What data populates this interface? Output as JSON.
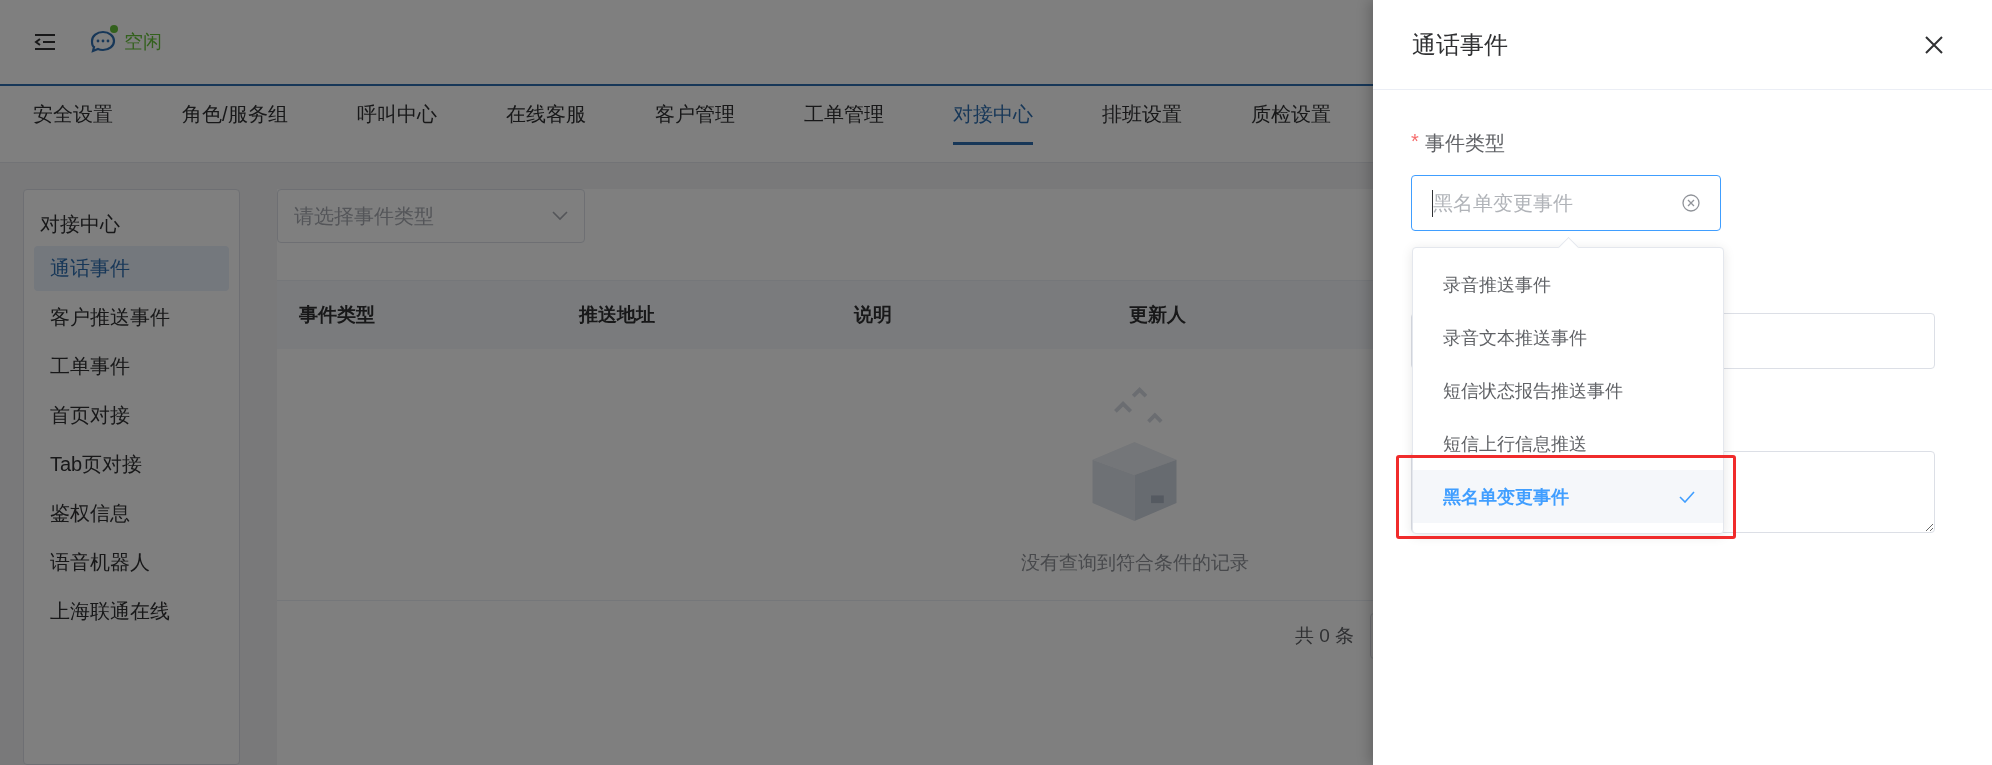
{
  "header": {
    "status": "空闲"
  },
  "nav_tabs": [
    {
      "label": "安全设置",
      "selected": false
    },
    {
      "label": "角色/服务组",
      "selected": false
    },
    {
      "label": "呼叫中心",
      "selected": false
    },
    {
      "label": "在线客服",
      "selected": false
    },
    {
      "label": "客户管理",
      "selected": false
    },
    {
      "label": "工单管理",
      "selected": false
    },
    {
      "label": "对接中心",
      "selected": true
    },
    {
      "label": "排班设置",
      "selected": false
    },
    {
      "label": "质检设置",
      "selected": false
    }
  ],
  "sidebar": {
    "title": "对接中心",
    "items": [
      {
        "label": "通话事件",
        "selected": true
      },
      {
        "label": "客户推送事件",
        "selected": false
      },
      {
        "label": "工单事件",
        "selected": false
      },
      {
        "label": "首页对接",
        "selected": false
      },
      {
        "label": "Tab页对接",
        "selected": false
      },
      {
        "label": "鉴权信息",
        "selected": false
      },
      {
        "label": "语音机器人",
        "selected": false
      },
      {
        "label": "上海联通在线",
        "selected": false
      }
    ]
  },
  "filter": {
    "placeholder": "请选择事件类型"
  },
  "table": {
    "columns": [
      "事件类型",
      "推送地址",
      "说明",
      "更新人"
    ],
    "empty_text": "没有查询到符合条件的记录"
  },
  "pagination": {
    "total": "共 0 条"
  },
  "drawer": {
    "title": "通话事件",
    "field": {
      "label": "事件类型",
      "required_mark": "*",
      "placeholder": "黑名单变更事件"
    },
    "options": [
      {
        "label": "录音推送事件",
        "selected": false
      },
      {
        "label": "录音文本推送事件",
        "selected": false
      },
      {
        "label": "短信状态报告推送事件",
        "selected": false
      },
      {
        "label": "短信上行信息推送",
        "selected": false
      },
      {
        "label": "黑名单变更事件",
        "selected": true
      }
    ],
    "highlight_box": true
  }
}
